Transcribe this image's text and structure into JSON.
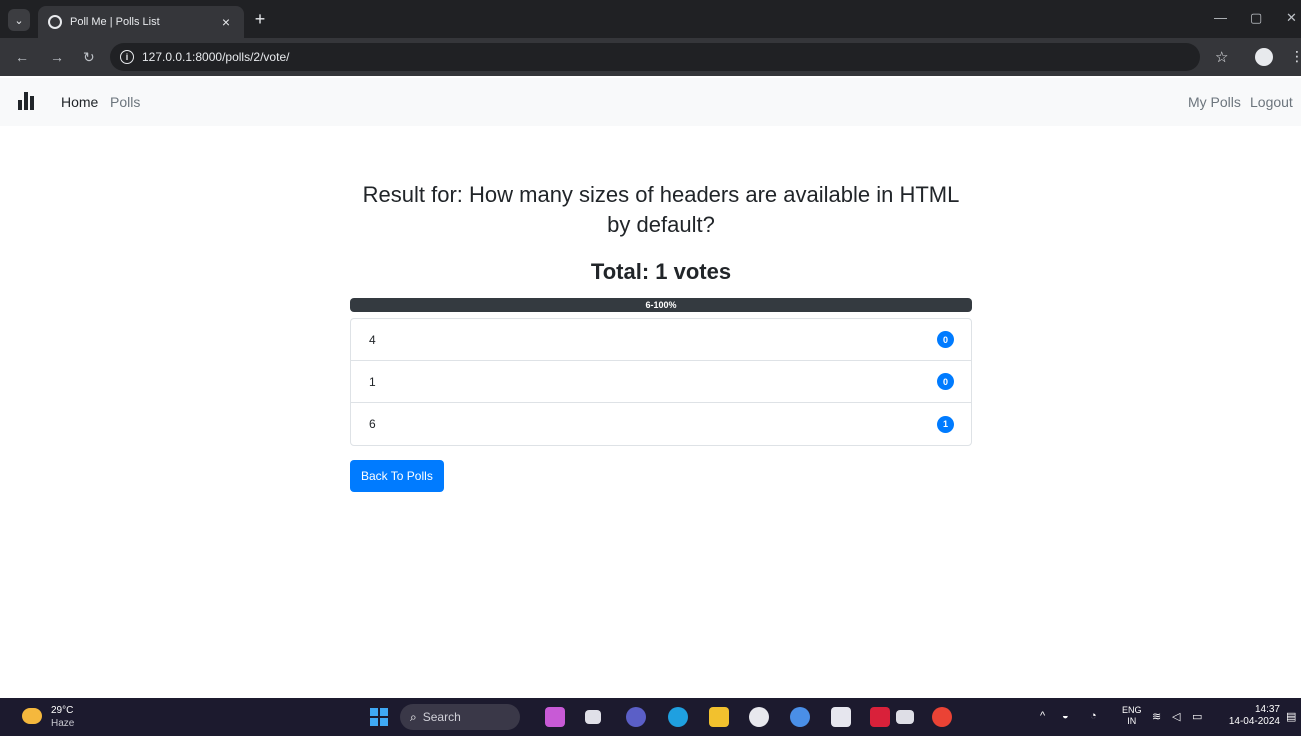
{
  "browser": {
    "tab_title": "Poll Me | Polls List",
    "url": "127.0.0.1:8000/polls/2/vote/",
    "new_tab_label": "+",
    "close_label": "×"
  },
  "navbar": {
    "home": "Home",
    "polls": "Polls",
    "my_polls": "My Polls",
    "logout": "Logout"
  },
  "result": {
    "title": "Result for: How many sizes of headers are available in HTML by default?",
    "total": "Total: 1 votes",
    "progress_label": "6-100%",
    "progress_percent": 100,
    "choices": [
      {
        "text": "4",
        "votes": "0"
      },
      {
        "text": "1",
        "votes": "0"
      },
      {
        "text": "6",
        "votes": "1"
      }
    ],
    "back_button": "Back To Polls"
  },
  "taskbar": {
    "weather_temp": "29°C",
    "weather_desc": "Haze",
    "search_placeholder": "Search",
    "lang_line1": "ENG",
    "lang_line2": "IN",
    "time": "14:37",
    "date": "14-04-2024"
  },
  "colors": {
    "primary": "#007bff",
    "progress": "#343a40",
    "navbar_bg": "#f8f9fa"
  }
}
